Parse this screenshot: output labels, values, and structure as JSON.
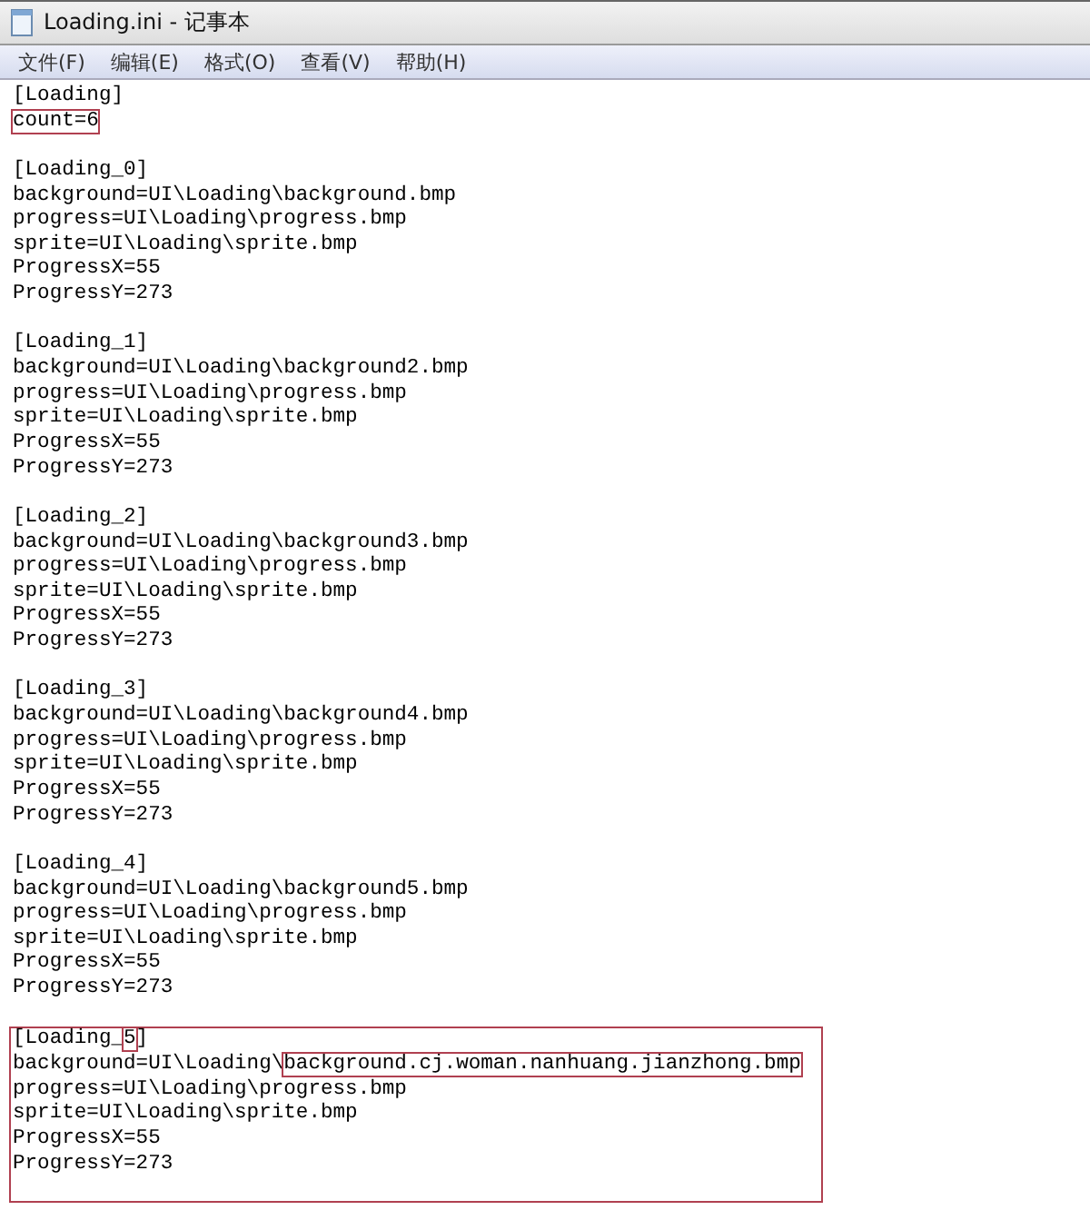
{
  "window": {
    "title": "Loading.ini - 记事本"
  },
  "menu": [
    "文件(F)",
    "编辑(E)",
    "格式(O)",
    "查看(V)",
    "帮助(H)"
  ],
  "sections": [
    {
      "boxed": false,
      "lines": [
        [
          {
            "text": "[Loading]",
            "boxed": false
          }
        ],
        [
          {
            "text": "count=6",
            "boxed": true
          }
        ]
      ]
    },
    {
      "boxed": false,
      "lines": [
        [
          {
            "text": "[Loading_0]",
            "boxed": false
          }
        ],
        [
          {
            "text": "background=UI\\Loading\\background.bmp",
            "boxed": false
          }
        ],
        [
          {
            "text": "progress=UI\\Loading\\progress.bmp",
            "boxed": false
          }
        ],
        [
          {
            "text": "sprite=UI\\Loading\\sprite.bmp",
            "boxed": false
          }
        ],
        [
          {
            "text": "ProgressX=55",
            "boxed": false
          }
        ],
        [
          {
            "text": "ProgressY=273",
            "boxed": false
          }
        ]
      ]
    },
    {
      "boxed": false,
      "lines": [
        [
          {
            "text": "[Loading_1]",
            "boxed": false
          }
        ],
        [
          {
            "text": "background=UI\\Loading\\background2.bmp",
            "boxed": false
          }
        ],
        [
          {
            "text": "progress=UI\\Loading\\progress.bmp",
            "boxed": false
          }
        ],
        [
          {
            "text": "sprite=UI\\Loading\\sprite.bmp",
            "boxed": false
          }
        ],
        [
          {
            "text": "ProgressX=55",
            "boxed": false
          }
        ],
        [
          {
            "text": "ProgressY=273",
            "boxed": false
          }
        ]
      ]
    },
    {
      "boxed": false,
      "lines": [
        [
          {
            "text": "[Loading_2]",
            "boxed": false
          }
        ],
        [
          {
            "text": "background=UI\\Loading\\background3.bmp",
            "boxed": false
          }
        ],
        [
          {
            "text": "progress=UI\\Loading\\progress.bmp",
            "boxed": false
          }
        ],
        [
          {
            "text": "sprite=UI\\Loading\\sprite.bmp",
            "boxed": false
          }
        ],
        [
          {
            "text": "ProgressX=55",
            "boxed": false
          }
        ],
        [
          {
            "text": "ProgressY=273",
            "boxed": false
          }
        ]
      ]
    },
    {
      "boxed": false,
      "lines": [
        [
          {
            "text": "[Loading_3]",
            "boxed": false
          }
        ],
        [
          {
            "text": "background=UI\\Loading\\background4.bmp",
            "boxed": false
          }
        ],
        [
          {
            "text": "progress=UI\\Loading\\progress.bmp",
            "boxed": false
          }
        ],
        [
          {
            "text": "sprite=UI\\Loading\\sprite.bmp",
            "boxed": false
          }
        ],
        [
          {
            "text": "ProgressX=55",
            "boxed": false
          }
        ],
        [
          {
            "text": "ProgressY=273",
            "boxed": false
          }
        ]
      ]
    },
    {
      "boxed": false,
      "lines": [
        [
          {
            "text": "[Loading_4]",
            "boxed": false
          }
        ],
        [
          {
            "text": "background=UI\\Loading\\background5.bmp",
            "boxed": false
          }
        ],
        [
          {
            "text": "progress=UI\\Loading\\progress.bmp",
            "boxed": false
          }
        ],
        [
          {
            "text": "sprite=UI\\Loading\\sprite.bmp",
            "boxed": false
          }
        ],
        [
          {
            "text": "ProgressX=55",
            "boxed": false
          }
        ],
        [
          {
            "text": "ProgressY=273",
            "boxed": false
          }
        ]
      ]
    },
    {
      "boxed": true,
      "lines": [
        [
          {
            "text": "[Loading_",
            "boxed": false
          },
          {
            "text": "5",
            "boxed": true
          },
          {
            "text": "]",
            "boxed": false
          }
        ],
        [
          {
            "text": "background=UI\\Loading\\",
            "boxed": false
          },
          {
            "text": "background.cj.woman.nanhuang.jianzhong.bmp",
            "boxed": true
          }
        ],
        [
          {
            "text": "progress=UI\\Loading\\progress.bmp",
            "boxed": false
          }
        ],
        [
          {
            "text": "sprite=UI\\Loading\\sprite.bmp",
            "boxed": false
          }
        ],
        [
          {
            "text": "ProgressX=55",
            "boxed": false
          }
        ],
        [
          {
            "text": "ProgressY=273",
            "boxed": false
          }
        ]
      ]
    }
  ]
}
